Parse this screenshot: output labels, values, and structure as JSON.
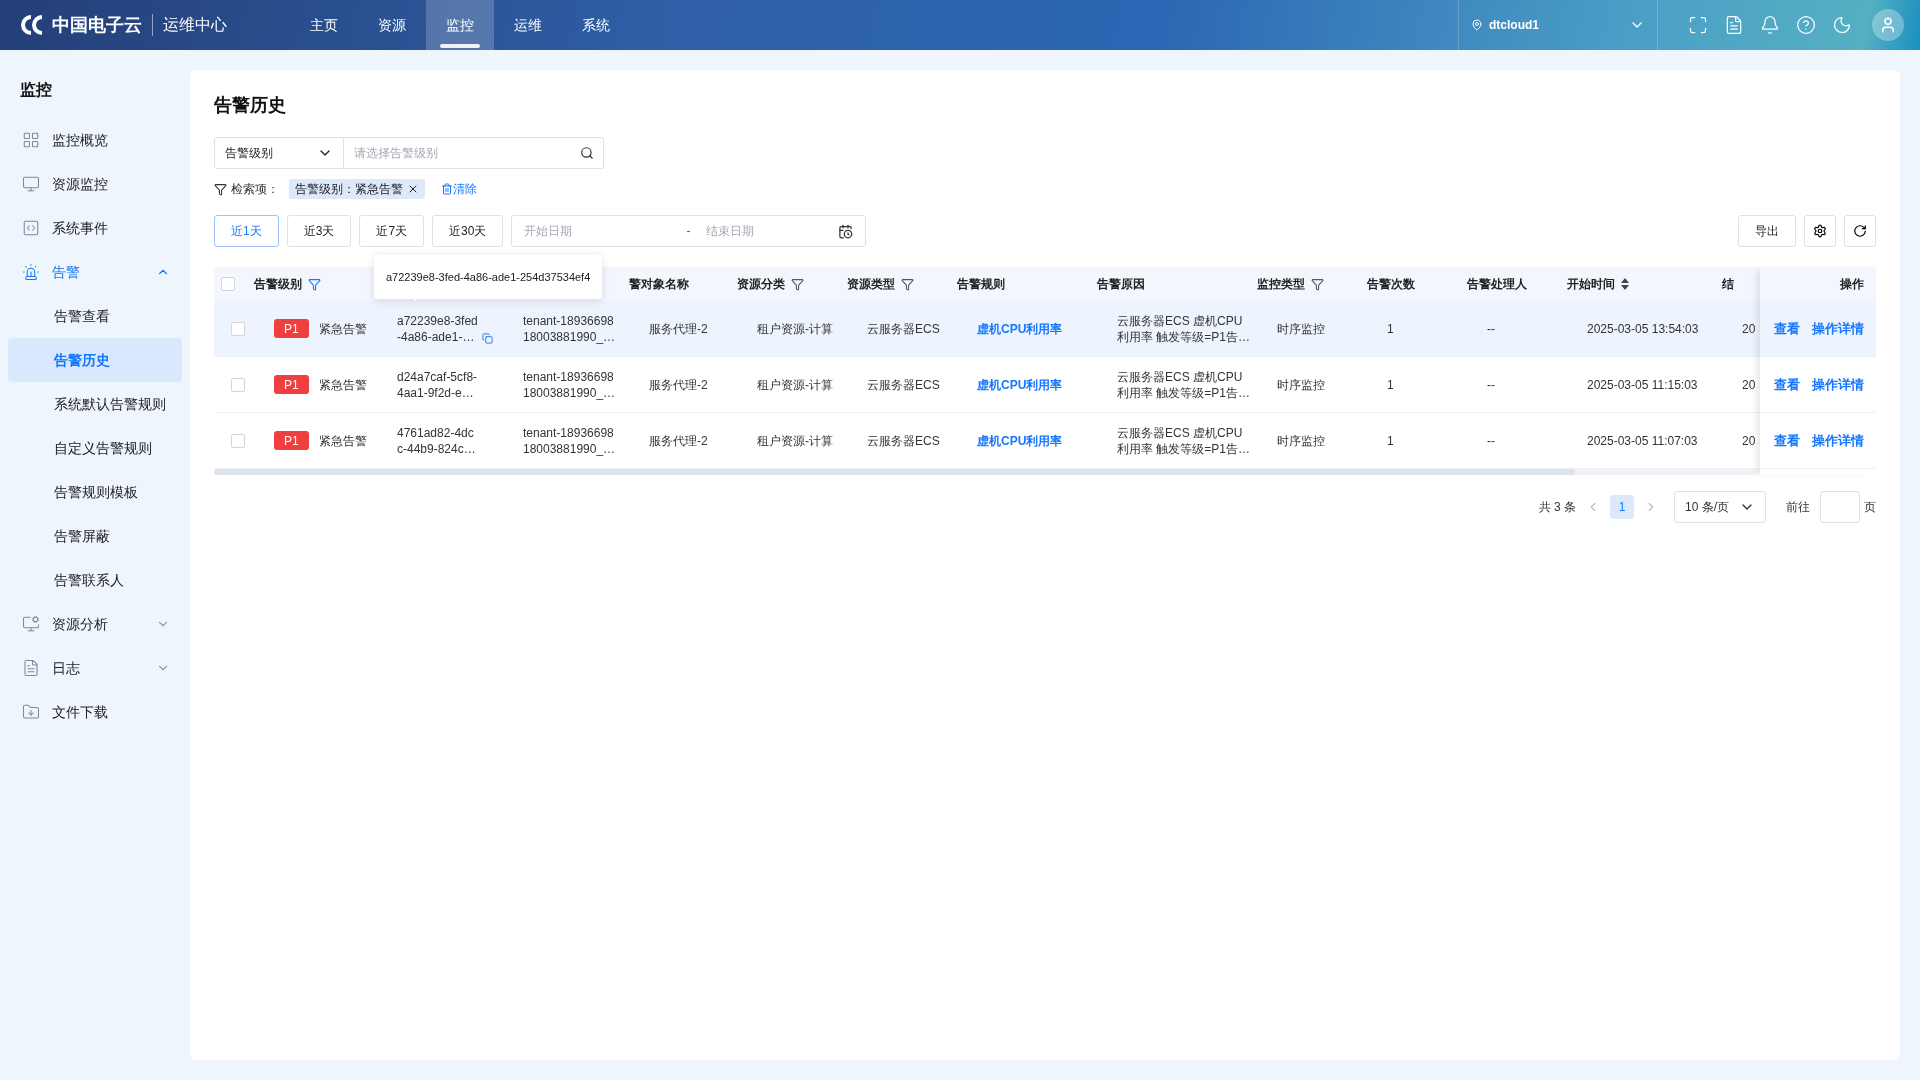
{
  "header": {
    "logo": "中国电子云",
    "product": "运维中心",
    "nav": [
      {
        "label": "主页",
        "selected": false
      },
      {
        "label": "资源",
        "selected": false
      },
      {
        "label": "监控",
        "selected": true
      },
      {
        "label": "运维",
        "selected": false
      },
      {
        "label": "系统",
        "selected": false
      }
    ],
    "region": "dtcloud1"
  },
  "sidebar": {
    "title": "监控",
    "items": [
      {
        "label": "监控概览",
        "kind": "link",
        "selected": false
      },
      {
        "label": "资源监控",
        "kind": "link",
        "selected": false
      },
      {
        "label": "系统事件",
        "kind": "link",
        "selected": false
      },
      {
        "label": "告警",
        "kind": "group",
        "selected": true,
        "expanded": true,
        "children": [
          {
            "label": "告警查看",
            "selected": false
          },
          {
            "label": "告警历史",
            "selected": true
          },
          {
            "label": "系统默认告警规则",
            "selected": false
          },
          {
            "label": "自定义告警规则",
            "selected": false
          },
          {
            "label": "告警规则模板",
            "selected": false
          },
          {
            "label": "告警屏蔽",
            "selected": false
          },
          {
            "label": "告警联系人",
            "selected": false
          }
        ]
      },
      {
        "label": "资源分析",
        "kind": "group",
        "selected": false,
        "expanded": false
      },
      {
        "label": "日志",
        "kind": "group",
        "selected": false,
        "expanded": false
      },
      {
        "label": "文件下载",
        "kind": "link",
        "selected": false
      }
    ]
  },
  "page": {
    "title": "告警历史",
    "search": {
      "field": "告警级别",
      "placeholder": "请选择告警级别"
    },
    "criteria": {
      "label": "检索项：",
      "tags": [
        {
          "text": "告警级别：紧急告警"
        }
      ],
      "clear": "清除"
    },
    "ranges": [
      {
        "label": "近1天",
        "selected": true
      },
      {
        "label": "近3天",
        "selected": false
      },
      {
        "label": "近7天",
        "selected": false
      },
      {
        "label": "近30天",
        "selected": false
      }
    ],
    "date": {
      "start_placeholder": "开始日期",
      "separator": "-",
      "end_placeholder": "结束日期"
    },
    "export": "导出"
  },
  "table": {
    "columns": [
      {
        "label": "告警级别",
        "filter": true,
        "active_filter": true
      },
      {
        "label": "警对象名称",
        "filter": false
      },
      {
        "label": "资源分类",
        "filter": true,
        "active_filter": false
      },
      {
        "label": "资源类型",
        "filter": true,
        "active_filter": false
      },
      {
        "label": "告警规则",
        "filter": false
      },
      {
        "label": "告警原因",
        "filter": false
      },
      {
        "label": "监控类型",
        "filter": true,
        "active_filter": false
      },
      {
        "label": "告警次数",
        "filter": false
      },
      {
        "label": "告警处理人",
        "filter": false
      },
      {
        "label": "开始时间",
        "filter": false,
        "sortable": true
      },
      {
        "label": "结",
        "filter": false
      }
    ],
    "all_checked": false,
    "action_header": "操作",
    "tooltip": "a72239e8-3fed-4a86-ade1-254d37534ef4",
    "rows": [
      {
        "checked": false,
        "highlighted": true,
        "priority": "P1",
        "severity": "紧急告警",
        "id": "a72239e8-3fed\n-4a86-ade1-…",
        "tenant": "tenant-18936698\n18003881990_…",
        "object": "服务代理-2",
        "category": "租户资源-计算",
        "type": "云服务器ECS",
        "rule": "虚机CPU利用率",
        "reason": "云服务器ECS 虚机CPU\n利用率 触发等级=P1告…",
        "monitor": "时序监控",
        "count": "1",
        "handler": "--",
        "start": "2025-03-05 13:54:03",
        "end": "20",
        "actions": [
          "查看",
          "操作详情"
        ]
      },
      {
        "checked": false,
        "highlighted": false,
        "priority": "P1",
        "severity": "紧急告警",
        "id": "d24a7caf-5cf8-\n4aa1-9f2d-e…",
        "tenant": "tenant-18936698\n18003881990_…",
        "object": "服务代理-2",
        "category": "租户资源-计算",
        "type": "云服务器ECS",
        "rule": "虚机CPU利用率",
        "reason": "云服务器ECS 虚机CPU\n利用率 触发等级=P1告…",
        "monitor": "时序监控",
        "count": "1",
        "handler": "--",
        "start": "2025-03-05 11:15:03",
        "end": "20",
        "actions": [
          "查看",
          "操作详情"
        ]
      },
      {
        "checked": false,
        "highlighted": false,
        "priority": "P1",
        "severity": "紧急告警",
        "id": "4761ad82-4dc\nc-44b9-824c…",
        "tenant": "tenant-18936698\n18003881990_…",
        "object": "服务代理-2",
        "category": "租户资源-计算",
        "type": "云服务器ECS",
        "rule": "虚机CPU利用率",
        "reason": "云服务器ECS 虚机CPU\n利用率 触发等级=P1告…",
        "monitor": "时序监控",
        "count": "1",
        "handler": "--",
        "start": "2025-03-05 11:07:03",
        "end": "20",
        "actions": [
          "查看",
          "操作详情"
        ]
      }
    ]
  },
  "pagination": {
    "total": "共 3 条",
    "pages": [
      {
        "label": "1",
        "selected": true
      }
    ],
    "page_size": "10 条/页",
    "goto": "前往",
    "unit": "页"
  }
}
